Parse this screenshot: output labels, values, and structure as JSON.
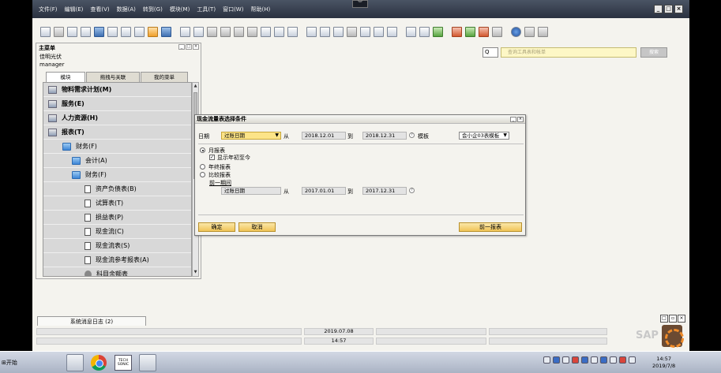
{
  "menubar": {
    "items": [
      "文件(F)",
      "编辑(E)",
      "查看(V)",
      "数据(A)",
      "转到(G)",
      "模块(M)",
      "工具(T)",
      "窗口(W)",
      "帮助(H)"
    ],
    "dropdown_glyph": "︾",
    "window_buttons": [
      "_",
      "□",
      "×"
    ]
  },
  "search": {
    "placeholder": "查询工具表和帐单",
    "button_label": "搜索",
    "icon_label": "Q"
  },
  "main_menu": {
    "title": "主菜单",
    "user_line1": "佳明光伏",
    "user_line2": "manager",
    "tabs": [
      "模块",
      "拖拽与关联",
      "我的菜单"
    ],
    "tree": [
      {
        "label": "物料需求计划(M)",
        "bold": true,
        "icon": "mrp-icon"
      },
      {
        "label": "服务(E)",
        "bold": true,
        "icon": "service-icon"
      },
      {
        "label": "人力资源(H)",
        "bold": true,
        "icon": "hr-icon"
      },
      {
        "label": "报表(T)",
        "bold": true,
        "icon": "reports-icon"
      },
      {
        "label": "财务(F)",
        "bold": false,
        "icon": "folder-icon"
      },
      {
        "label": "会计(A)",
        "bold": false,
        "icon": "folder-icon"
      },
      {
        "label": "财务(F)",
        "bold": false,
        "icon": "folder-icon"
      },
      {
        "label": "资产负债表(B)",
        "bold": false,
        "icon": "document-icon"
      },
      {
        "label": "试算表(T)",
        "bold": false,
        "icon": "document-icon"
      },
      {
        "label": "损益表(P)",
        "bold": false,
        "icon": "document-icon"
      },
      {
        "label": "现金流(C)",
        "bold": false,
        "icon": "document-icon"
      },
      {
        "label": "现金流表(S)",
        "bold": false,
        "icon": "document-icon"
      },
      {
        "label": "现金流参考报表(A)",
        "bold": false,
        "icon": "document-icon"
      },
      {
        "label": "科目余额表",
        "bold": false,
        "icon": "gear-icon"
      }
    ]
  },
  "dialog": {
    "title": "现金流量表选择条件",
    "date_label": "日期",
    "date_type": "过账日期",
    "from_label": "从",
    "from_date": "2018.12.01",
    "to_label": "到",
    "to_date": "2018.12.31",
    "template_label": "模板",
    "template_value": "会小企03表模板",
    "radio_monthly": "月报表",
    "check_ytd": "显示年初至今",
    "radio_annual": "年终报表",
    "radio_compare": "比较报表",
    "prev_period": "前一期间",
    "cmp_date_type": "过账日期",
    "cmp_from_date": "2017.01.01",
    "cmp_to_date": "2017.12.31",
    "ok_button": "确定",
    "cancel_button": "取消",
    "prev_report_button": "前一报表"
  },
  "bottom": {
    "tab_label": "系统消息日志 (2)",
    "status_date": "2019.07.08",
    "status_time": "14:57",
    "brand": "SAP"
  },
  "taskbar": {
    "start_label": "开始",
    "techsonic_label": "TECH SONIC",
    "clock_time": "14:57",
    "clock_date": "2019/7/8"
  }
}
